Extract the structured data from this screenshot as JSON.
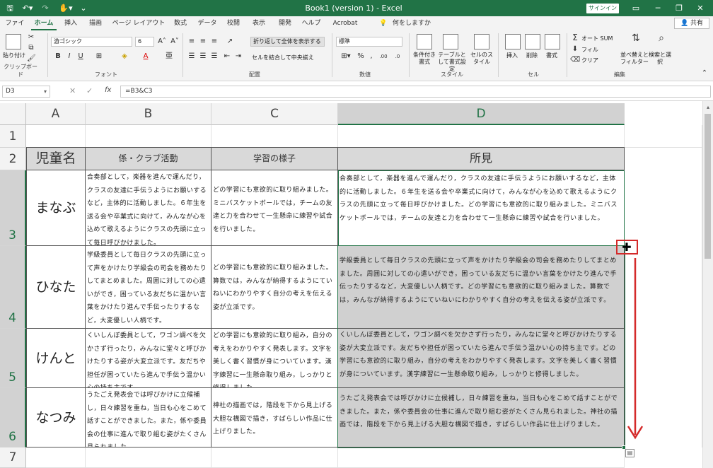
{
  "titlebar": {
    "title": "Book1 (version 1)  -  Excel",
    "signin": "サインイン",
    "min": "─",
    "restore": "❐",
    "close": "✕"
  },
  "tabs": [
    "ファイル",
    "ホーム",
    "挿入",
    "描画",
    "ページ レイアウト",
    "数式",
    "データ",
    "校閲",
    "表示",
    "開発",
    "ヘルプ",
    "Acrobat"
  ],
  "tell_me": "何をしますか",
  "share": "共有",
  "ribbon": {
    "paste": "貼り付け",
    "clipboard": "クリップボード",
    "font_name": "游ゴシック",
    "font_size": "6",
    "font": "フォント",
    "wrap": "折り返して全体を表示する",
    "merge": "セルを結合して中央揃え",
    "align": "配置",
    "num_format": "標準",
    "number": "数値",
    "cond": "条件付き書式",
    "table": "テーブルとして書式設定",
    "cellstyle": "セルのスタイル",
    "styles": "スタイル",
    "insert": "挿入",
    "delete": "削除",
    "format": "書式",
    "cells": "セル",
    "autosum": "オート SUM",
    "fill": "フィル",
    "clear": "クリア",
    "sort": "並べ替えとフィルター",
    "find": "検索と選択",
    "editing": "編集"
  },
  "formula": {
    "namebox": "D3",
    "fx": "fx",
    "content": "=B3&C3"
  },
  "columns": [
    "A",
    "B",
    "C",
    "D"
  ],
  "rows": [
    "1",
    "2",
    "3",
    "4",
    "5",
    "6",
    "7"
  ],
  "headers": {
    "a": "児童名",
    "b": "係・クラブ活動",
    "c": "学習の様子",
    "d": "所見"
  },
  "students": [
    {
      "name": "まなぶ",
      "b": "合奏部として，楽器を進んで運んだり，クラスの友達に手伝うようにお願いするなど，主体的に活動しました。６年生を送る会や卒業式に向けて，みんなが心を込めて歌えるようにクラスの先頭に立って毎日呼びかけました。",
      "c": "どの学習にも意欲的に取り組みました。ミニバスケットボールでは，チームの友達と力を合わせて一生懸命に練習や試合を行いました。",
      "d": "合奏部として，楽器を進んで運んだり，クラスの友達に手伝うようにお願いするなど，主体的に活動しました。６年生を送る会や卒業式に向けて，みんなが心を込めて歌えるようにクラスの先頭に立って毎日呼びかけました。どの学習にも意欲的に取り組みました。ミニバスケットボールでは，チームの友達と力を合わせて一生懸命に練習や試合を行いました。"
    },
    {
      "name": "ひなた",
      "b": "学級委員として毎日クラスの先頭に立って声をかけたり学級会の司会を務めたりしてまとめました。周囲に対しての心遣いができ，困っている友だちに温かい言葉をかけたり進んで手伝ったりするなど，大変優しい人柄です。",
      "c": "どの学習にも意欲的に取り組みました。算数では，みんなが納得するようにていねいにわかりやすく自分の考えを伝える姿が立派です。",
      "d": "学級委員として毎日クラスの先頭に立って声をかけたり学級会の司会を務めたりしてまとめました。周囲に対しての心遣いができ，困っている友だちに温かい言葉をかけたり進んで手伝ったりするなど，大変優しい人柄です。どの学習にも意欲的に取り組みました。算数では，みんなが納得するようにていねいにわかりやすく自分の考えを伝える姿が立派です。"
    },
    {
      "name": "けんと",
      "b": "くいしんぼ委員として，ワゴン調べを欠かさず行ったり，みんなに堂々と呼びかけたりする姿が大変立派です。友だちや担任が困っていたら進んで手伝う温かい心の持ち主です。",
      "c": "どの学習にも意欲的に取り組み，自分の考えをわかりやすく発表します。文字を美しく書く習慣が身についています。漢字練習に一生懸命取り組み，しっかりと修得しました。",
      "d": "くいしんぼ委員として，ワゴン調べを欠かさず行ったり，みんなに堂々と呼びかけたりする姿が大変立派です。友だちや担任が困っていたら進んで手伝う温かい心の持ち主です。どの学習にも意欲的に取り組み，自分の考えをわかりやすく発表します。文字を美しく書く習慣が身についています。漢字練習に一生懸命取り組み，しっかりと修得しました。"
    },
    {
      "name": "なつみ",
      "b": "うたごえ発表会では呼びかけに立候補し，日々練習を重ね，当日も心をこめて話すことができました。また，係や委員会の仕事に進んで取り組む姿がたくさん見られました。",
      "c": "神社の描画では，階段を下から見上げる大胆な構図で描き，すばらしい作品に仕上げりました。",
      "d": "うたごえ発表会では呼びかけに立候補し，日々練習を重ね，当日も心をこめて話すことができました。また，係や委員会の仕事に進んで取り組む姿がたくさん見られました。神社の描画では，階段を下から見上げる大胆な構図で描き，すばらしい作品に仕上げりました。"
    }
  ],
  "accent": "#217346",
  "annotation_color": "#d42a2a"
}
